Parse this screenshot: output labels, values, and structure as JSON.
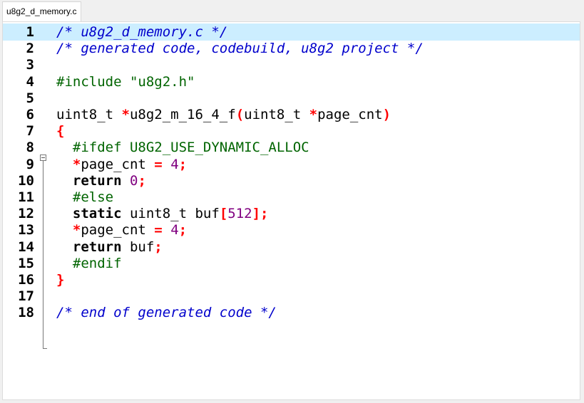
{
  "tab": {
    "label": "u8g2_d_memory.c"
  },
  "colors": {
    "current_line": "#cceeff",
    "comment": "#0000cc",
    "preprocessor": "#006400",
    "operator": "#ff0000",
    "number": "#800080"
  },
  "lines": [
    {
      "num": "1",
      "tokens": [
        {
          "t": "/* u8g2_d_memory.c */",
          "c": "comment"
        }
      ]
    },
    {
      "num": "2",
      "tokens": [
        {
          "t": "/* generated code, codebuild, u8g2 project */",
          "c": "comment"
        }
      ]
    },
    {
      "num": "3",
      "tokens": []
    },
    {
      "num": "4",
      "tokens": [
        {
          "t": "#include \"u8g2.h\"",
          "c": "pre"
        }
      ]
    },
    {
      "num": "5",
      "tokens": []
    },
    {
      "num": "6",
      "tokens": [
        {
          "t": "uint8_t ",
          "c": "plain"
        },
        {
          "t": "*",
          "c": "op"
        },
        {
          "t": "u8g2_m_16_4_f",
          "c": "plain"
        },
        {
          "t": "(",
          "c": "op"
        },
        {
          "t": "uint8_t ",
          "c": "plain"
        },
        {
          "t": "*",
          "c": "op"
        },
        {
          "t": "page_cnt",
          "c": "plain"
        },
        {
          "t": ")",
          "c": "op"
        }
      ]
    },
    {
      "num": "7",
      "tokens": [
        {
          "t": "{",
          "c": "op"
        }
      ]
    },
    {
      "num": "8",
      "tokens": [
        {
          "t": "  #ifdef U8G2_USE_DYNAMIC_ALLOC",
          "c": "pre"
        }
      ]
    },
    {
      "num": "9",
      "tokens": [
        {
          "t": "  ",
          "c": "plain"
        },
        {
          "t": "*",
          "c": "op"
        },
        {
          "t": "page_cnt ",
          "c": "plain"
        },
        {
          "t": "=",
          "c": "op"
        },
        {
          "t": " ",
          "c": "plain"
        },
        {
          "t": "4",
          "c": "num"
        },
        {
          "t": ";",
          "c": "op"
        }
      ]
    },
    {
      "num": "10",
      "tokens": [
        {
          "t": "  ",
          "c": "plain"
        },
        {
          "t": "return",
          "c": "kw"
        },
        {
          "t": " ",
          "c": "plain"
        },
        {
          "t": "0",
          "c": "num"
        },
        {
          "t": ";",
          "c": "op"
        }
      ]
    },
    {
      "num": "11",
      "tokens": [
        {
          "t": "  #else",
          "c": "pre"
        }
      ]
    },
    {
      "num": "12",
      "tokens": [
        {
          "t": "  ",
          "c": "plain"
        },
        {
          "t": "static",
          "c": "kw"
        },
        {
          "t": " uint8_t buf",
          "c": "plain"
        },
        {
          "t": "[",
          "c": "op"
        },
        {
          "t": "512",
          "c": "num"
        },
        {
          "t": "];",
          "c": "op"
        }
      ]
    },
    {
      "num": "13",
      "tokens": [
        {
          "t": "  ",
          "c": "plain"
        },
        {
          "t": "*",
          "c": "op"
        },
        {
          "t": "page_cnt ",
          "c": "plain"
        },
        {
          "t": "=",
          "c": "op"
        },
        {
          "t": " ",
          "c": "plain"
        },
        {
          "t": "4",
          "c": "num"
        },
        {
          "t": ";",
          "c": "op"
        }
      ]
    },
    {
      "num": "14",
      "tokens": [
        {
          "t": "  ",
          "c": "plain"
        },
        {
          "t": "return",
          "c": "kw"
        },
        {
          "t": " buf",
          "c": "plain"
        },
        {
          "t": ";",
          "c": "op"
        }
      ]
    },
    {
      "num": "15",
      "tokens": [
        {
          "t": "  #endif",
          "c": "pre"
        }
      ]
    },
    {
      "num": "16",
      "tokens": [
        {
          "t": "}",
          "c": "op"
        }
      ]
    },
    {
      "num": "17",
      "tokens": []
    },
    {
      "num": "18",
      "tokens": [
        {
          "t": "/* end of generated code */",
          "c": "comment"
        }
      ]
    }
  ]
}
